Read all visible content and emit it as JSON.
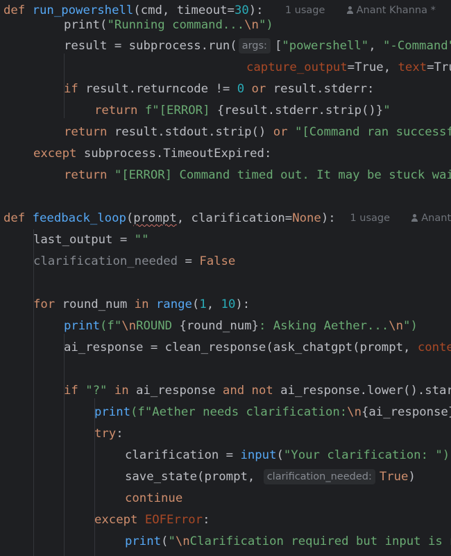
{
  "inlay": {
    "usage_label": "1 usage",
    "author_1": "Anant Khanna *",
    "author_2": "Anant Khanna *",
    "args_hint": "args:",
    "clar_hint": "clarification_needed:"
  },
  "code": {
    "l1": {
      "def": "def",
      "fn": "run_powershell",
      "rest": "(cmd, timeout=",
      "num": "30",
      "end": "):"
    },
    "l2": {
      "p1": "print(",
      "s": "\"Running command...",
      "esc": "\\n",
      "s2": "\")"
    },
    "l3": {
      "a": "result = subprocess.run(",
      "b": "[",
      "s1": "\"powershell\"",
      "c": ", ",
      "s2": "\"-Command\""
    },
    "l4": {
      "k1": "capture_output",
      "e1": "=True, ",
      "k2": "text",
      "e2": "=True"
    },
    "l5": {
      "if": "if",
      "a": " result.returncode != ",
      "n": "0",
      "sp": " ",
      "or": "or",
      "b": " result.stderr:"
    },
    "l6": {
      "ret": "return",
      "sp": " ",
      "f": "f\"[ERROR] ",
      "br": "{result.stderr.strip()}",
      "q": "\""
    },
    "l7": {
      "ret": "return",
      "a": " result.stdout.strip() ",
      "or": "or",
      "sp": " ",
      "s": "\"[Command ran successfully]\""
    },
    "l8": {
      "exc": "except",
      "a": " subprocess.TimeoutExpired:"
    },
    "l9": {
      "ret": "return",
      "sp": " ",
      "s": "\"[ERROR] Command timed out. It may be stuck waiting for input.\""
    },
    "l10": {
      "def": "def",
      "fn": "feedback_loop",
      "p": "(",
      "prompt": "prompt",
      "rest": ", clarification=",
      "none": "None",
      "end": "):"
    },
    "l11": {
      "a": "last_output = ",
      "s": "\"\""
    },
    "l12": {
      "a": "clarification_needed",
      "b": " = ",
      "f": "False"
    },
    "l13": {
      "for": "for",
      "a": " round_num ",
      "in": "in",
      "sp": " ",
      "range": "range",
      "b": "(",
      "n1": "1",
      "c": ", ",
      "n2": "10",
      "d": "):"
    },
    "l14": {
      "print": "print",
      "a": "(f\"",
      "esc": "\\n",
      "s": "ROUND ",
      "br": "{round_num}",
      "s2": ": Asking Aether...",
      "esc2": "\\n",
      "e": "\")"
    },
    "l15": {
      "a": "ai_response = clean_response(ask_chatgpt(prompt, ",
      "k": "context=last_output))"
    },
    "l16": {
      "if": "if",
      "sp": " ",
      "s": "\"?\"",
      "sp2": " ",
      "in": "in",
      "a": " ai_response ",
      "and": "and",
      "sp3": " ",
      "not": "not",
      "b": " ai_response.lower().startswith("
    },
    "l17": {
      "print": "print",
      "a": "(f\"Aether needs clarification:",
      "esc": "\\n",
      "br": "{ai_response}",
      "q": "\")"
    },
    "l18": {
      "try": "try",
      "c": ":"
    },
    "l19": {
      "a": "clarification = ",
      "input": "input",
      "b": "(",
      "s": "\"Your clarification: \")"
    },
    "l20": {
      "a": "save_state(prompt, ",
      "t": "True",
      ")": ")"
    },
    "l21": {
      "cont": "continue"
    },
    "l22": {
      "exc": "except",
      "sp": " ",
      "err": "EOFError",
      "c": ":"
    },
    "l23": {
      "print": "print",
      "a": "(",
      "s": "\"",
      "esc": "\\n",
      "s2": "Clarification required but input is not available.\")"
    }
  }
}
